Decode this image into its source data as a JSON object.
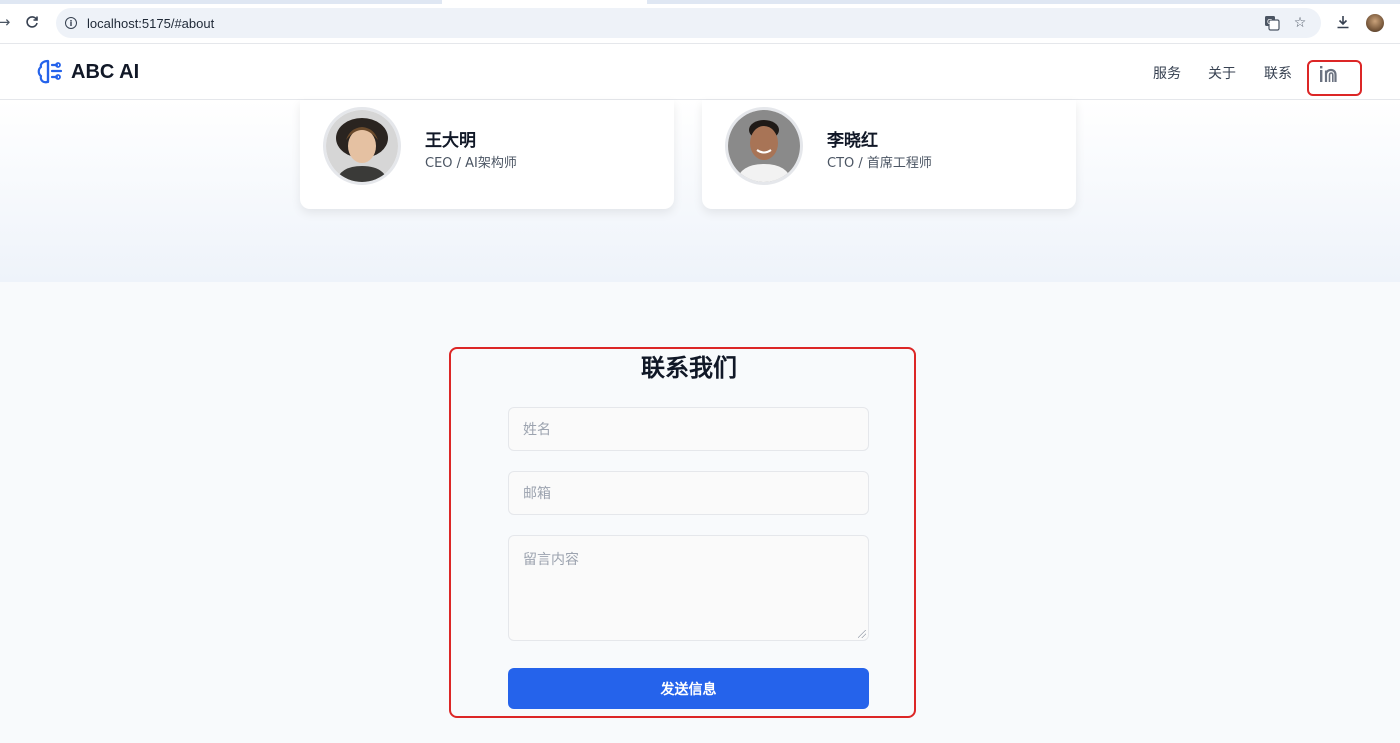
{
  "browser": {
    "url": "localhost:5175/#about",
    "icons": [
      "back-icon",
      "reload-icon",
      "site-info-icon",
      "translate-icon",
      "bookmark-star-icon",
      "download-icon",
      "profile-avatar"
    ]
  },
  "navbar": {
    "brand": "ABC AI",
    "links": [
      "服务",
      "关于",
      "联系"
    ],
    "social_icon": "linkedin-icon"
  },
  "team": [
    {
      "name": "王大明",
      "role": "CEO / AI架构师"
    },
    {
      "name": "李晓红",
      "role": "CTO / 首席工程师"
    }
  ],
  "contact": {
    "title": "联系我们",
    "name_placeholder": "姓名",
    "email_placeholder": "邮箱",
    "message_placeholder": "留言内容",
    "submit_label": "发送信息"
  },
  "colors": {
    "accent": "#2563eb",
    "highlight_outline": "#dc2626"
  }
}
